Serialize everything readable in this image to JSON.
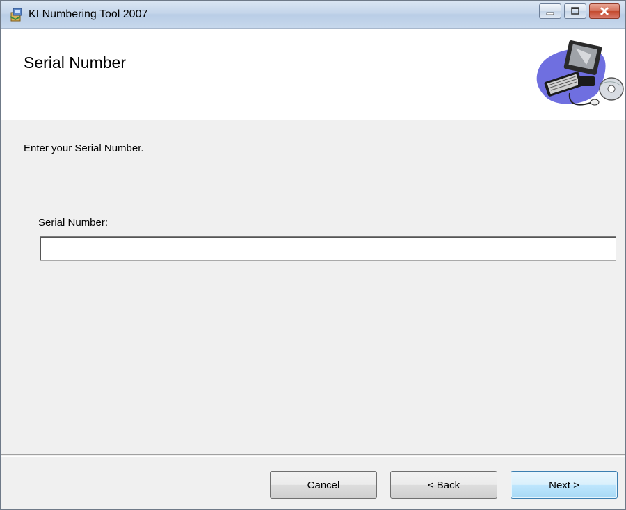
{
  "window": {
    "title": "KI Numbering Tool 2007",
    "app_icon": "installer-package-icon",
    "caption_buttons": [
      "minimize-icon",
      "maximize-icon",
      "close-icon"
    ]
  },
  "banner": {
    "title": "Serial Number",
    "graphic": "computer-setup-icon"
  },
  "body": {
    "instruction": "Enter your Serial Number.",
    "serial_label": "Serial Number:",
    "serial_value": "",
    "serial_placeholder": ""
  },
  "footer": {
    "cancel_label": "Cancel",
    "back_label": "< Back",
    "next_label": "Next >"
  },
  "colors": {
    "titlebar": "#c4d5ea",
    "close_button": "#c44a2e",
    "default_button": "#bee6fd",
    "dialog_background": "#f0f0f0"
  }
}
